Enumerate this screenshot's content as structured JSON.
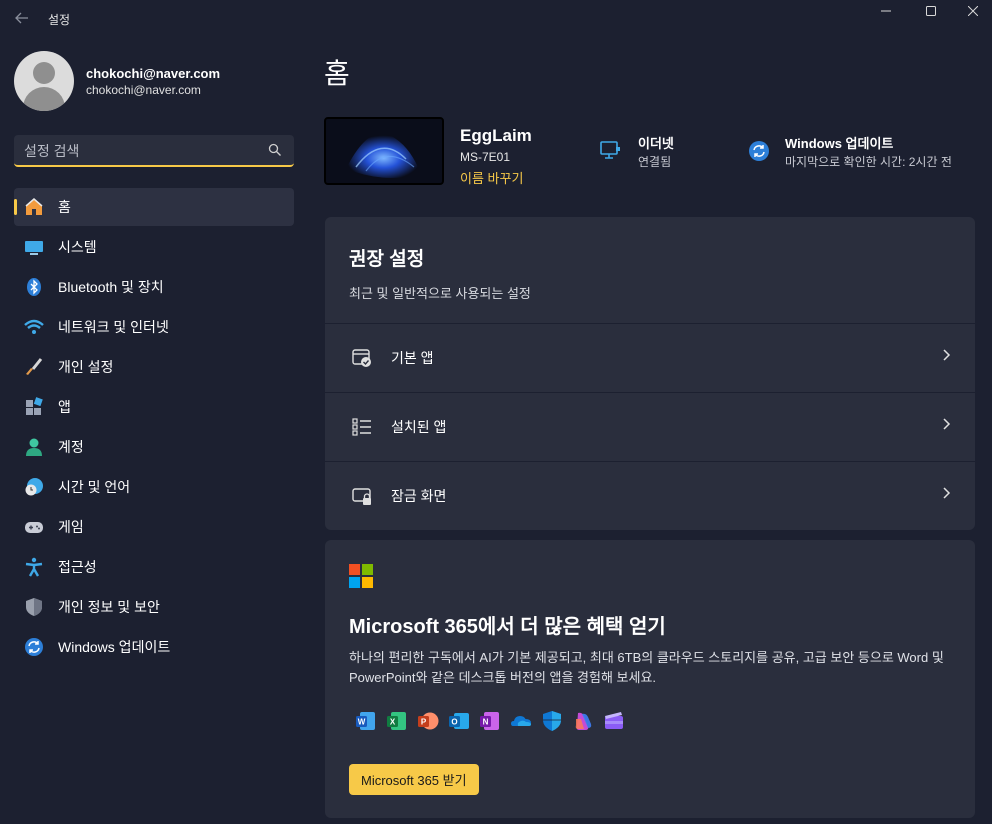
{
  "window": {
    "title": "설정"
  },
  "profile": {
    "name": "chokochi@naver.com",
    "email": "chokochi@naver.com"
  },
  "search": {
    "placeholder": "설정 검색"
  },
  "sidebar": {
    "items": [
      {
        "label": "홈",
        "icon": "home-icon"
      },
      {
        "label": "시스템",
        "icon": "system-icon"
      },
      {
        "label": "Bluetooth 및 장치",
        "icon": "bluetooth-icon"
      },
      {
        "label": "네트워크 및 인터넷",
        "icon": "wifi-icon"
      },
      {
        "label": "개인 설정",
        "icon": "brush-icon"
      },
      {
        "label": "앱",
        "icon": "apps-icon"
      },
      {
        "label": "계정",
        "icon": "account-icon"
      },
      {
        "label": "시간 및 언어",
        "icon": "time-language-icon"
      },
      {
        "label": "게임",
        "icon": "gamepad-icon"
      },
      {
        "label": "접근성",
        "icon": "accessibility-icon"
      },
      {
        "label": "개인 정보 및 보안",
        "icon": "shield-icon"
      },
      {
        "label": "Windows 업데이트",
        "icon": "windows-update-icon"
      }
    ]
  },
  "main": {
    "title": "홈",
    "device": {
      "name": "EggLaim",
      "model": "MS-7E01",
      "rename": "이름 바꾸기"
    },
    "network": {
      "title": "이더넷",
      "status": "연결됨"
    },
    "update": {
      "title": "Windows 업데이트",
      "status": "마지막으로 확인한 시간: 2시간 전"
    },
    "recommended": {
      "title": "권장 설정",
      "subtitle": "최근 및 일반적으로 사용되는 설정",
      "rows": [
        {
          "label": "기본 앱",
          "icon": "default-apps-icon"
        },
        {
          "label": "설치된 앱",
          "icon": "installed-apps-icon"
        },
        {
          "label": "잠금 화면",
          "icon": "lock-screen-icon"
        }
      ]
    },
    "m365": {
      "title": "Microsoft 365에서 더 많은 혜택 얻기",
      "description": "하나의 편리한 구독에서 AI가 기본 제공되고, 최대 6TB의 클라우드 스토리지를 공유, 고급 보안 등으로 Word 및 PowerPoint와 같은 데스크톱 버전의 앱을 경험해 보세요.",
      "button": "Microsoft 365 받기",
      "apps": [
        "word-icon",
        "excel-icon",
        "powerpoint-icon",
        "outlook-icon",
        "onenote-icon",
        "onedrive-icon",
        "defender-icon",
        "copilot-icon",
        "clipchamp-icon"
      ]
    }
  },
  "colors": {
    "accent": "#f7c948",
    "background": "#1c2030",
    "card": "#2a2e3d"
  }
}
